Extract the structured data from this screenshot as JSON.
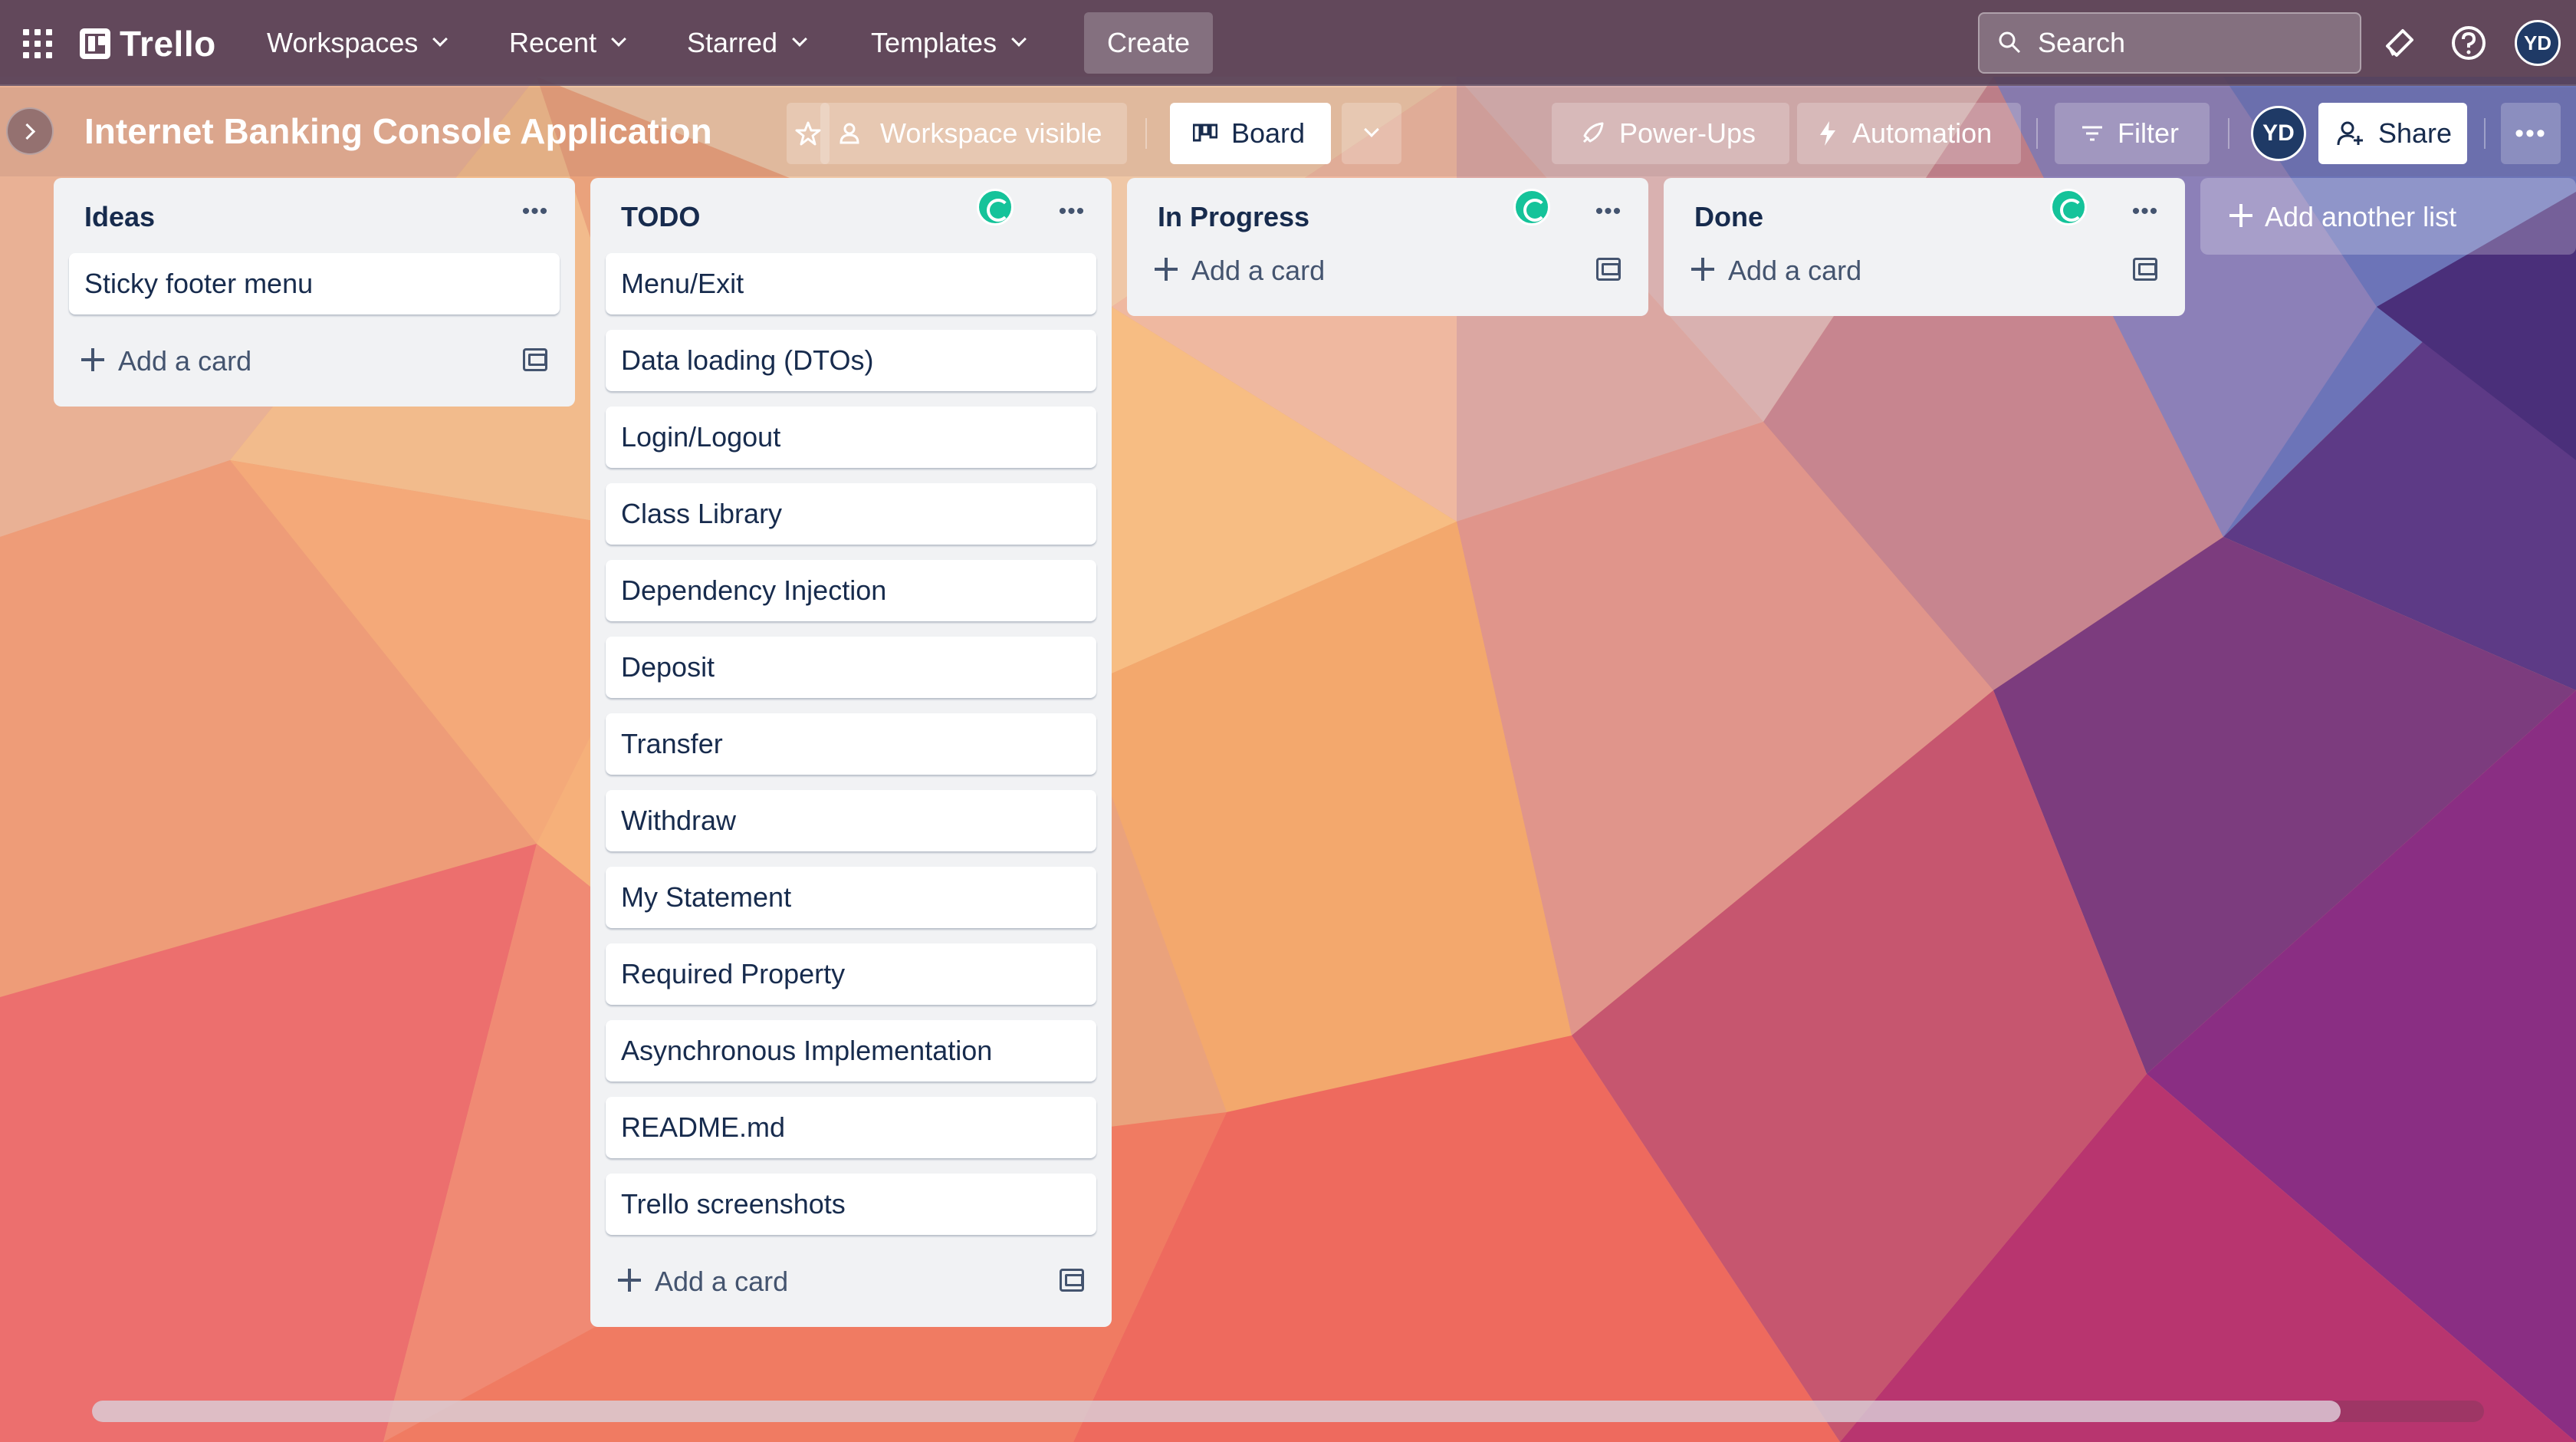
{
  "app": {
    "name": "Trello"
  },
  "topnav": {
    "items": [
      "Workspaces",
      "Recent",
      "Starred",
      "Templates"
    ],
    "create_label": "Create",
    "search_placeholder": "Search",
    "user_initials": "YD"
  },
  "board": {
    "title": "Internet Banking Console Application",
    "visibility_label": "Workspace visible",
    "view_label": "Board",
    "powerups_label": "Power-Ups",
    "automation_label": "Automation",
    "filter_label": "Filter",
    "member_initials": "YD",
    "share_label": "Share"
  },
  "lists": [
    {
      "title": "Ideas",
      "cards": [
        "Sticky footer menu"
      ],
      "add_label": "Add a card"
    },
    {
      "title": "TODO",
      "cards": [
        "Menu/Exit",
        "Data loading (DTOs)",
        "Login/Logout",
        "Class Library",
        "Dependency Injection",
        "Deposit",
        "Transfer",
        "Withdraw",
        "My Statement",
        "Required Property",
        "Asynchronous Implementation",
        "README.md",
        "Trello screenshots"
      ],
      "add_label": "Add a card"
    },
    {
      "title": "In Progress",
      "cards": [],
      "add_label": "Add a card"
    },
    {
      "title": "Done",
      "cards": [],
      "add_label": "Add a card"
    }
  ],
  "add_list_label": "Add another list",
  "scrollbar": {
    "visible_fraction": 0.94
  },
  "icons": [
    "apps-grid-icon",
    "trello-logo-icon",
    "search-icon",
    "megaphone-icon",
    "help-icon",
    "star-icon",
    "people-icon",
    "board-view-icon",
    "chevron-down-icon",
    "rocket-icon",
    "lightning-icon",
    "filter-icon",
    "add-person-icon",
    "more-icon",
    "grammarly-icon",
    "card-template-icon"
  ]
}
